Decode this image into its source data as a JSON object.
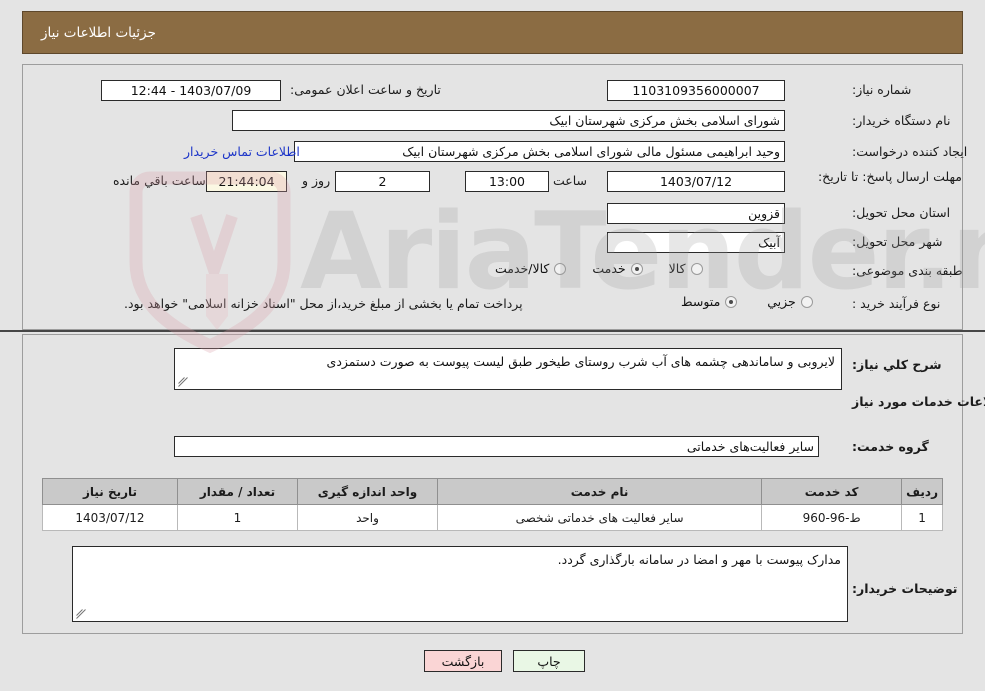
{
  "header": {
    "title": "جزئیات اطلاعات نیاز"
  },
  "top_form": {
    "need_number_label": "شماره نیاز:",
    "need_number_value": "1103109356000007",
    "public_announce_label": "تاریخ و ساعت اعلان عمومی:",
    "public_announce_value": "1403/07/09 - 12:44",
    "buyer_org_label": "نام دستگاه خریدار:",
    "buyer_org_value": "شورای اسلامی بخش مرکزی شهرستان ابیک",
    "requester_label": "ایجاد کننده درخواست:",
    "requester_value": "وحید ابراهیمی مسئول مالی شورای اسلامی بخش مرکزی شهرستان ابیک",
    "buyer_contact_link": "اطلاعات تماس خریدار",
    "deadline_label": "مهلت ارسال پاسخ: تا تاریخ:",
    "deadline_date": "1403/07/12",
    "time_label": "ساعت",
    "time_value": "13:00",
    "days_value": "2",
    "days_unit_label": "روز و",
    "countdown_value": "21:44:04",
    "countdown_suffix": "ساعت باقي مانده",
    "province_label": "استان محل تحویل:",
    "province_value": "قزوین",
    "city_label": "شهر محل تحویل:",
    "city_value": "آبیک",
    "category_label": "طبقه بندی موضوعی:",
    "category_options": [
      {
        "label": "کالا",
        "selected": false
      },
      {
        "label": "خدمت",
        "selected": true
      },
      {
        "label": "کالا/خدمت",
        "selected": false
      }
    ],
    "process_label": "نوع فرآیند خرید :",
    "process_options": [
      {
        "label": "جزیي",
        "selected": false
      },
      {
        "label": "متوسط",
        "selected": true
      }
    ],
    "process_note": "پرداخت تمام یا بخشی از مبلغ خرید،از محل \"اسناد خزانه اسلامی\" خواهد بود."
  },
  "middle": {
    "general_desc_label": "شرح کلي نیاز:",
    "general_desc_value": "لایروبی و ساماندهی چشمه های آب شرب روستای طیخور طبق لیست پیوست  به صورت دستمزدی",
    "services_info_title": "اطلاعات خدمات مورد نیاز",
    "service_group_label": "گروه خدمت:",
    "service_group_value": "سایر فعالیت‌های خدماتی"
  },
  "table": {
    "columns": [
      "ردیف",
      "کد خدمت",
      "نام خدمت",
      "واحد اندازه گیری",
      "تعداد / مقدار",
      "تاریخ نیاز"
    ],
    "rows": [
      {
        "row": "1",
        "code": "ط-96-960",
        "name": "سایر فعالیت های خدماتی شخصی",
        "unit": "واحد",
        "qty": "1",
        "date": "1403/07/12"
      }
    ]
  },
  "buyer_notes": {
    "label": "توضیحات خریدار:",
    "value": "مدارک پیوست با مهر و امضا در سامانه بارگذاری گردد."
  },
  "footer": {
    "back_label": "بازگشت",
    "print_label": "چاپ"
  },
  "watermark": {
    "text": "AriaTender.net"
  },
  "colors": {
    "header_bar": "#8b6c43",
    "page_bg": "#e4e4e4",
    "link": "#1b34c8",
    "back_button": "#fad5d5",
    "print_button": "#e9f7e5",
    "countdown_bg": "#fbf8e3",
    "table_header_bg": "#c9c9c9"
  }
}
